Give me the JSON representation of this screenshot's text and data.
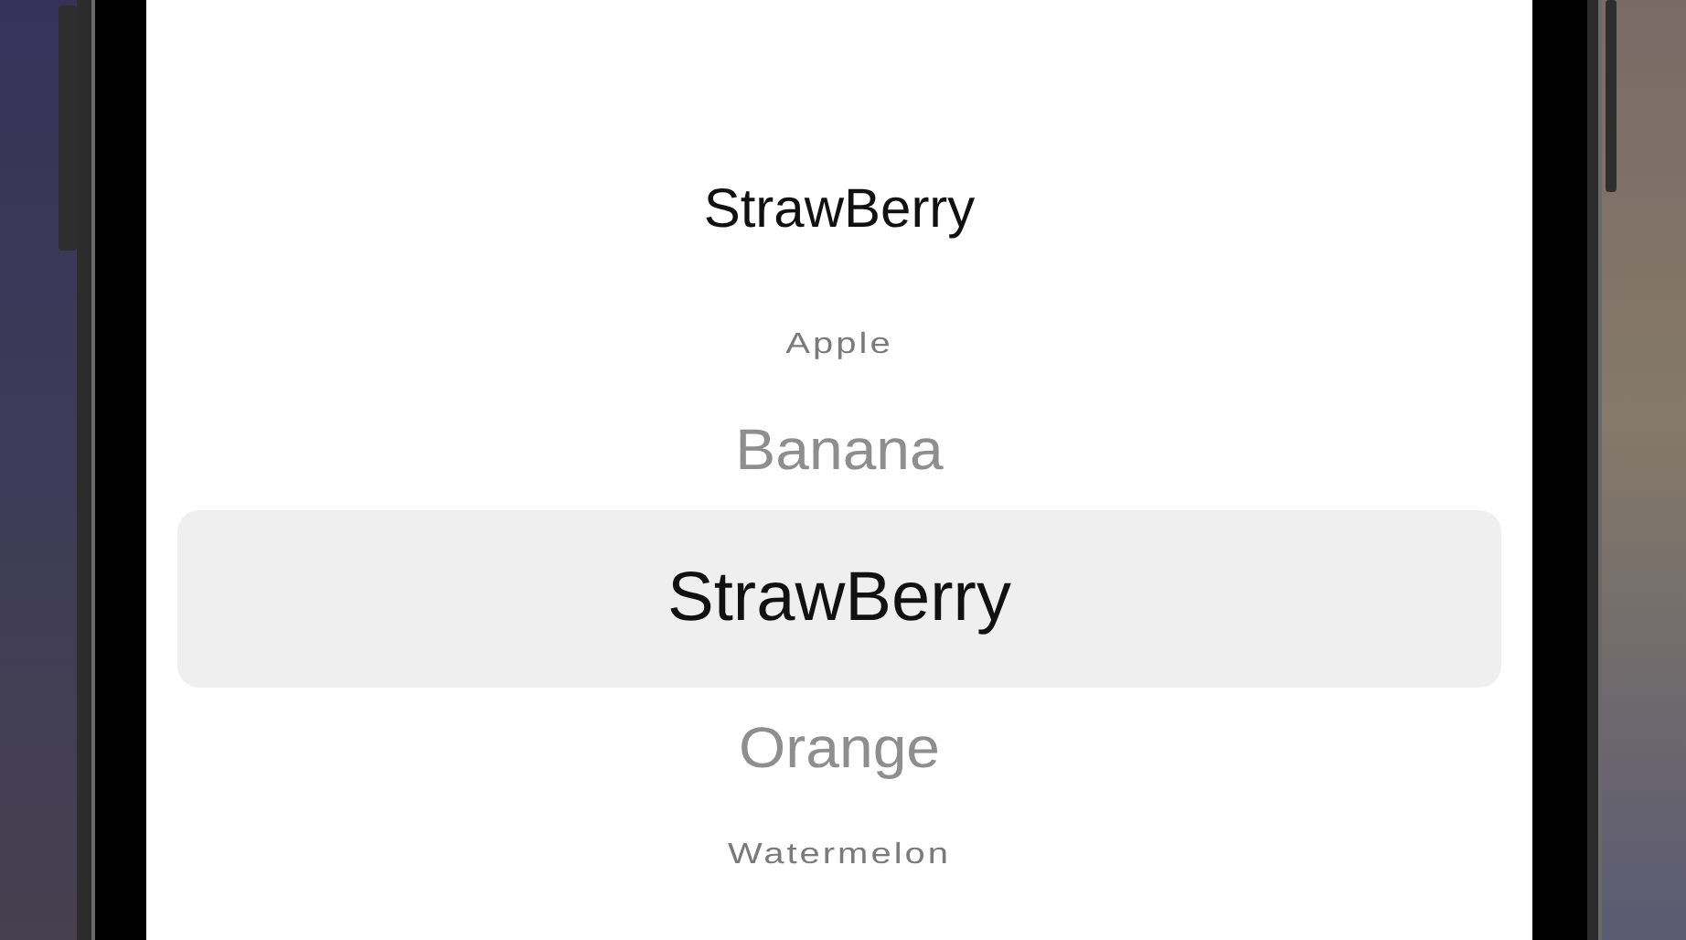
{
  "label": "StrawBerry",
  "picker": {
    "options": [
      {
        "label": "Apple",
        "selected": false
      },
      {
        "label": "Banana",
        "selected": false
      },
      {
        "label": "StrawBerry",
        "selected": true
      },
      {
        "label": "Orange",
        "selected": false
      },
      {
        "label": "Watermelon",
        "selected": false
      }
    ]
  }
}
